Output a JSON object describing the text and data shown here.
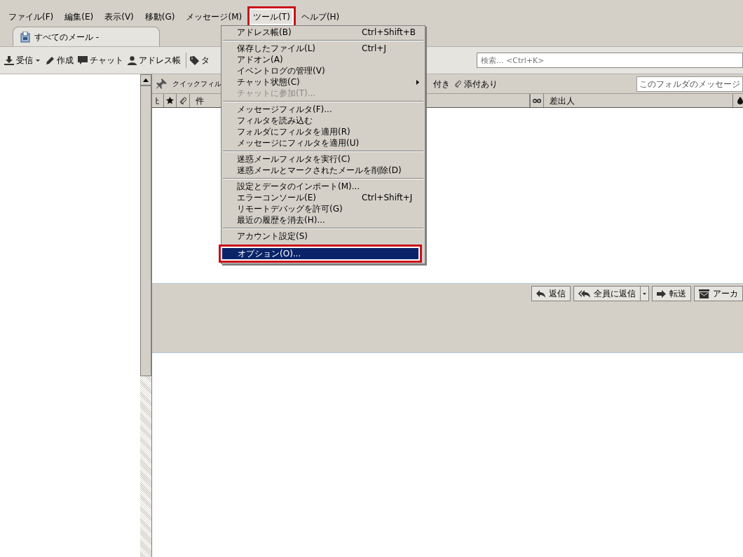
{
  "menubar": [
    {
      "label": "ファイル(F)",
      "selected": false,
      "annotated": false
    },
    {
      "label": "編集(E)",
      "selected": false,
      "annotated": false
    },
    {
      "label": "表示(V)",
      "selected": false,
      "annotated": false
    },
    {
      "label": "移動(G)",
      "selected": false,
      "annotated": false
    },
    {
      "label": "メッセージ(M)",
      "selected": false,
      "annotated": false
    },
    {
      "label": "ツール(T)",
      "selected": true,
      "annotated": true
    },
    {
      "label": "ヘルプ(H)",
      "selected": false,
      "annotated": false
    }
  ],
  "tabs": [
    {
      "label": "すべてのメール -",
      "selected": true
    }
  ],
  "toolbar": {
    "buttons": [
      {
        "label": "受信",
        "dropdown": true
      },
      {
        "label": "作成",
        "dropdown": false
      },
      {
        "label": "チャット",
        "dropdown": false
      },
      {
        "label": "アドレス帳",
        "dropdown": false
      },
      {
        "label": "タ",
        "dropdown": false
      }
    ],
    "search": {
      "placeholder": "検索... <Ctrl+K>"
    }
  },
  "quick_filter": {
    "label": "クイックフィル",
    "items": [
      "付き",
      "添付あり"
    ],
    "search": {
      "placeholder": "このフォルダのメッセージ"
    }
  },
  "columns": [
    {
      "label": "件"
    },
    {
      "label": "差出人"
    }
  ],
  "message_buttons": [
    {
      "label": "返信",
      "dropdown": false
    },
    {
      "label": "全員に返信",
      "dropdown": true
    },
    {
      "label": "転送",
      "dropdown": false
    },
    {
      "label": "アーカ",
      "dropdown": false
    }
  ],
  "menu": [
    {
      "kind": "item",
      "label": "アドレス帳(B)",
      "shortcut": "Ctrl+Shift+B",
      "disabled": false,
      "submenu": false,
      "selected": false,
      "annotated": false
    },
    {
      "kind": "separator"
    },
    {
      "kind": "item",
      "label": "保存したファイル(L)",
      "shortcut": "Ctrl+J",
      "disabled": false,
      "submenu": false,
      "selected": false,
      "annotated": false
    },
    {
      "kind": "item",
      "label": "アドオン(A)",
      "disabled": false,
      "submenu": false,
      "selected": false,
      "annotated": false
    },
    {
      "kind": "item",
      "label": "イベントログの管理(V)",
      "disabled": false,
      "submenu": false,
      "selected": false,
      "annotated": false
    },
    {
      "kind": "item",
      "label": "チャット状態(C)",
      "disabled": false,
      "submenu": true,
      "selected": false,
      "annotated": false
    },
    {
      "kind": "item",
      "label": "チャットに参加(T)...",
      "disabled": true,
      "submenu": false,
      "selected": false,
      "annotated": false
    },
    {
      "kind": "separator"
    },
    {
      "kind": "item",
      "label": "メッセージフィルタ(F)...",
      "disabled": false,
      "submenu": false,
      "selected": false,
      "annotated": false
    },
    {
      "kind": "item",
      "label": "フィルタを読み込む",
      "disabled": false,
      "submenu": false,
      "selected": false,
      "annotated": false
    },
    {
      "kind": "item",
      "label": "フォルダにフィルタを適用(R)",
      "disabled": false,
      "submenu": false,
      "selected": false,
      "annotated": false
    },
    {
      "kind": "item",
      "label": "メッセージにフィルタを適用(U)",
      "disabled": false,
      "submenu": false,
      "selected": false,
      "annotated": false
    },
    {
      "kind": "separator"
    },
    {
      "kind": "item",
      "label": "迷惑メールフィルタを実行(C)",
      "disabled": false,
      "submenu": false,
      "selected": false,
      "annotated": false
    },
    {
      "kind": "item",
      "label": "迷惑メールとマークされたメールを削除(D)",
      "disabled": false,
      "submenu": false,
      "selected": false,
      "annotated": false
    },
    {
      "kind": "separator"
    },
    {
      "kind": "item",
      "label": "設定とデータのインポート(M)...",
      "disabled": false,
      "submenu": false,
      "selected": false,
      "annotated": false
    },
    {
      "kind": "item",
      "label": "エラーコンソール(E)",
      "shortcut": "Ctrl+Shift+J",
      "disabled": false,
      "submenu": false,
      "selected": false,
      "annotated": false
    },
    {
      "kind": "item",
      "label": "リモートデバッグを許可(G)",
      "disabled": false,
      "submenu": false,
      "selected": false,
      "annotated": false
    },
    {
      "kind": "item",
      "label": "最近の履歴を消去(H)...",
      "disabled": false,
      "submenu": false,
      "selected": false,
      "annotated": false
    },
    {
      "kind": "separator"
    },
    {
      "kind": "item",
      "label": "アカウント設定(S)",
      "disabled": false,
      "submenu": false,
      "selected": false,
      "annotated": false
    },
    {
      "kind": "item",
      "label": "オプション(O)...",
      "disabled": false,
      "submenu": false,
      "selected": true,
      "annotated": true
    }
  ]
}
